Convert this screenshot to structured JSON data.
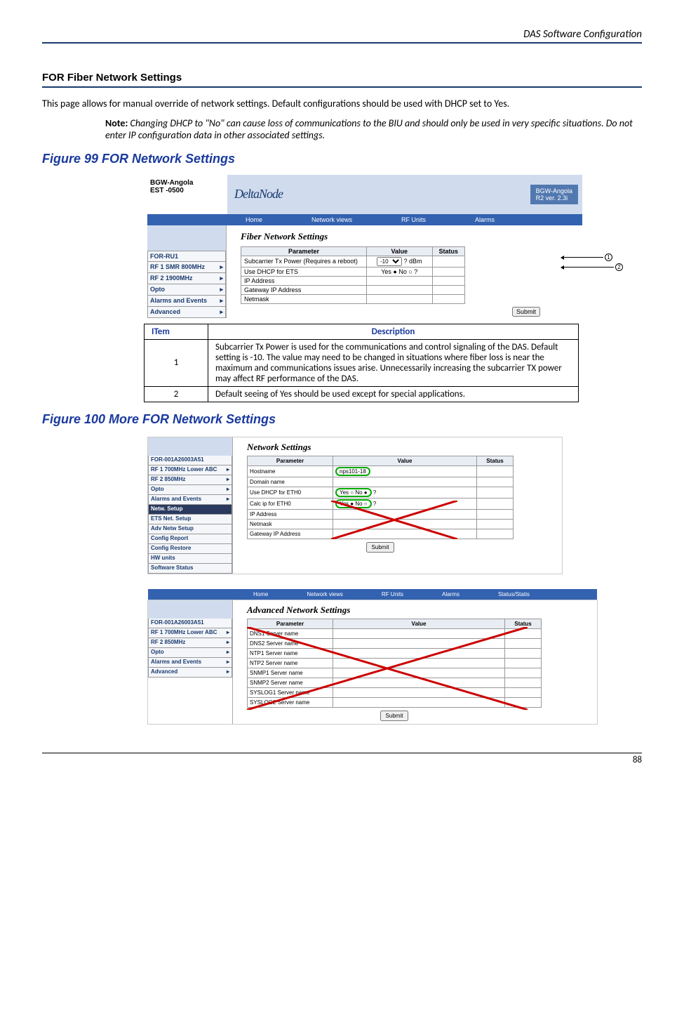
{
  "page": {
    "header": "DAS Software Configuration",
    "number": "88"
  },
  "section": {
    "title": "FOR Fiber Network Settings",
    "intro": "This page allows for manual override of network settings. Default configurations should be used with DHCP set to Yes.",
    "note_label": "Note:",
    "note_text": "Changing DHCP to \"No\" can cause loss of communications to the BIU and should only be used in very specific situations. Do not enter IP configuration data in other associated settings."
  },
  "figure99": {
    "title": "Figure 99    FOR Network Settings",
    "site_name": "BGW-Angola",
    "site_tz": "EST -0500",
    "brand": "DeltaNode",
    "version_box1": "BGW-Angola",
    "version_box2": "R2 ver. 2.3i",
    "nav": [
      "Home",
      "Network views",
      "RF Units",
      "Alarms"
    ],
    "sidebar": [
      "FOR-RU1",
      "RF 1 SMR 800MHz",
      "RF 2 1900MHz",
      "Opto",
      "Alarms and Events",
      "Advanced"
    ],
    "panel_title": "Fiber Network Settings",
    "table_headers": [
      "Parameter",
      "Value",
      "Status"
    ],
    "rows": [
      {
        "p": "Subcarrier Tx Power (Requires a reboot)",
        "v": "-10",
        "unit": "dBm"
      },
      {
        "p": "Use DHCP for ETS",
        "v": "Yes ● No ○"
      },
      {
        "p": "IP Address",
        "v": ""
      },
      {
        "p": "Gateway IP Address",
        "v": ""
      },
      {
        "p": "Netmask",
        "v": ""
      }
    ],
    "submit": "Submit",
    "callout1": "1",
    "callout2": "2"
  },
  "desc_table": {
    "h1": "ITem",
    "h2": "Description",
    "r1_item": "1",
    "r1_desc": "Subcarrier Tx Power is used for the communications and control signaling of the DAS.  Default setting is -10.  The value may need to be changed in situations where fiber loss is near the maximum and communications issues arise.  Unnecessarily increasing the subcarrier TX power may affect RF performance of the DAS.",
    "r2_item": "2",
    "r2_desc": "Default seeing of Yes should be used except for special applications."
  },
  "figure100": {
    "title": "Figure 100    More FOR Network Settings",
    "sidebar2": [
      "FOR-001A26003A51",
      "RF 1 700MHz Lower ABC",
      "RF 2 850MHz",
      "Opto",
      "Alarms and Events"
    ],
    "sidebar2_sub": [
      "Netw. Setup",
      "ETS Net. Setup",
      "Adv Netw Setup",
      "Config Report",
      "Config Restore",
      "HW units",
      "Software Status"
    ],
    "panel2_title": "Network Settings",
    "table2_headers": [
      "Parameter",
      "Value",
      "Status"
    ],
    "rows2": [
      {
        "p": "Hostname",
        "v": "nps101-18"
      },
      {
        "p": "Domain name",
        "v": ""
      },
      {
        "p": "Use DHCP for ETH0",
        "v": "Yes ○ No ●"
      },
      {
        "p": "Calc ip for ETH0",
        "v": "Yes ● No ○"
      },
      {
        "p": "IP Address",
        "v": ""
      },
      {
        "p": "Netmask",
        "v": ""
      },
      {
        "p": "Gateway IP Address",
        "v": ""
      }
    ],
    "nav3": [
      "Home",
      "Network views",
      "RF Units",
      "Alarms",
      "Status/Statis"
    ],
    "sidebar3": [
      "FOR-001A26003A51",
      "RF 1 700MHz Lower ABC",
      "RF 2 850MHz",
      "Opto",
      "Alarms and Events",
      "Advanced"
    ],
    "panel3_title": "Advanced Network Settings",
    "rows3": [
      {
        "p": "DNS1 Server name"
      },
      {
        "p": "DNS2 Server name"
      },
      {
        "p": "NTP1 Server name"
      },
      {
        "p": "NTP2 Server name"
      },
      {
        "p": "SNMP1 Server name"
      },
      {
        "p": "SNMP2 Server name"
      },
      {
        "p": "SYSLOG1 Server name"
      },
      {
        "p": "SYSLOG2 Server name"
      }
    ],
    "submit": "Submit"
  }
}
